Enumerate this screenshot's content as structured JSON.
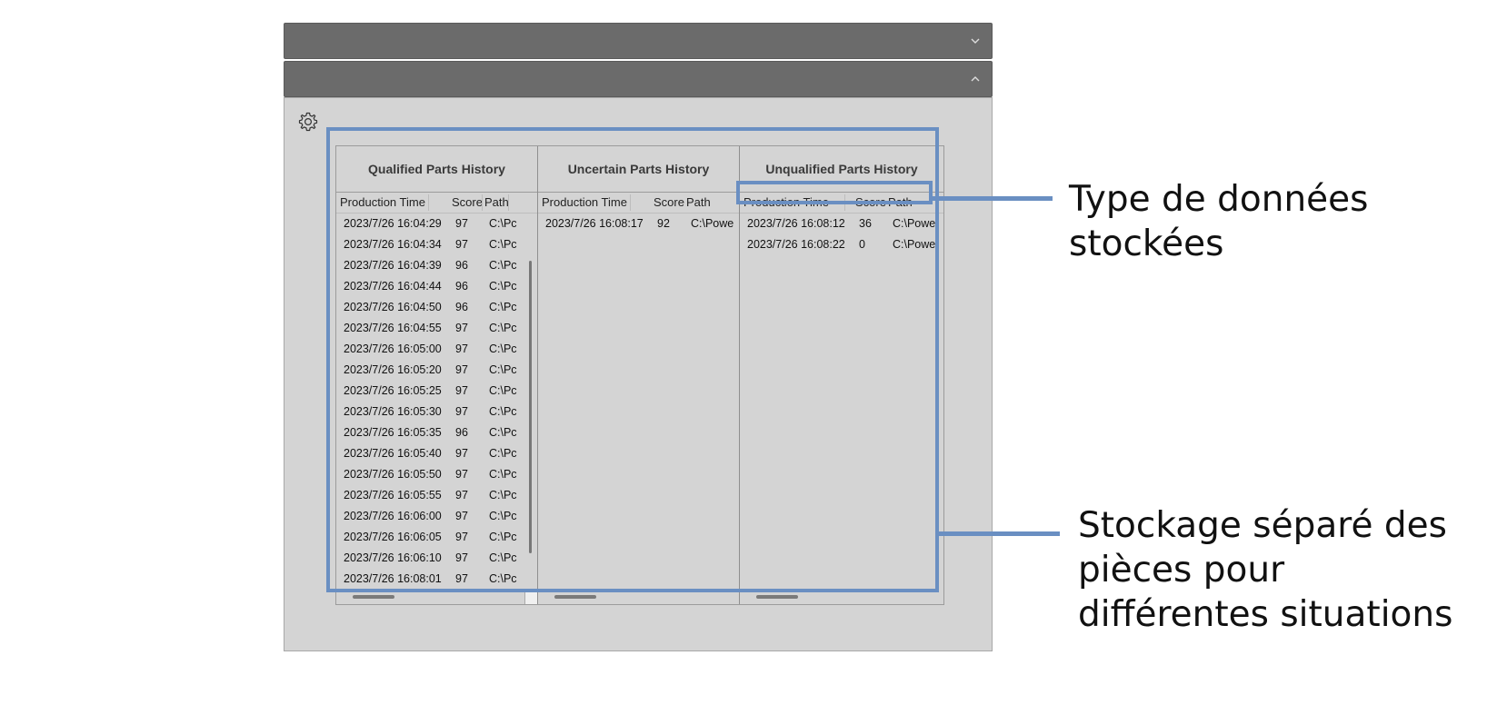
{
  "app": {
    "section_collapsed": {
      "title": "",
      "chevron_icon": "chevron-down-icon"
    },
    "section_expanded": {
      "title": "",
      "chevron_icon": "chevron-up-icon"
    },
    "settings_icon": "gear-icon"
  },
  "history": {
    "columns": [
      "Production Time",
      "Score",
      "Path"
    ],
    "qualified": {
      "title": "Qualified Parts History",
      "rows": [
        {
          "time": "2023/7/26 16:04:29",
          "score": "97",
          "path": "C:\\Pc"
        },
        {
          "time": "2023/7/26 16:04:34",
          "score": "97",
          "path": "C:\\Pc"
        },
        {
          "time": "2023/7/26 16:04:39",
          "score": "96",
          "path": "C:\\Pc"
        },
        {
          "time": "2023/7/26 16:04:44",
          "score": "96",
          "path": "C:\\Pc"
        },
        {
          "time": "2023/7/26 16:04:50",
          "score": "96",
          "path": "C:\\Pc"
        },
        {
          "time": "2023/7/26 16:04:55",
          "score": "97",
          "path": "C:\\Pc"
        },
        {
          "time": "2023/7/26 16:05:00",
          "score": "97",
          "path": "C:\\Pc"
        },
        {
          "time": "2023/7/26 16:05:20",
          "score": "97",
          "path": "C:\\Pc"
        },
        {
          "time": "2023/7/26 16:05:25",
          "score": "97",
          "path": "C:\\Pc"
        },
        {
          "time": "2023/7/26 16:05:30",
          "score": "97",
          "path": "C:\\Pc"
        },
        {
          "time": "2023/7/26 16:05:35",
          "score": "96",
          "path": "C:\\Pc"
        },
        {
          "time": "2023/7/26 16:05:40",
          "score": "97",
          "path": "C:\\Pc"
        },
        {
          "time": "2023/7/26 16:05:50",
          "score": "97",
          "path": "C:\\Pc"
        },
        {
          "time": "2023/7/26 16:05:55",
          "score": "97",
          "path": "C:\\Pc"
        },
        {
          "time": "2023/7/26 16:06:00",
          "score": "97",
          "path": "C:\\Pc"
        },
        {
          "time": "2023/7/26 16:06:05",
          "score": "97",
          "path": "C:\\Pc"
        },
        {
          "time": "2023/7/26 16:06:10",
          "score": "97",
          "path": "C:\\Pc"
        },
        {
          "time": "2023/7/26 16:08:01",
          "score": "97",
          "path": "C:\\Pc"
        }
      ]
    },
    "uncertain": {
      "title": "Uncertain Parts History",
      "rows": [
        {
          "time": "2023/7/26 16:08:17",
          "score": "92",
          "path": "C:\\Powe"
        }
      ]
    },
    "unqualified": {
      "title": "Unqualified Parts History",
      "rows": [
        {
          "time": "2023/7/26 16:08:12",
          "score": "36",
          "path": "C:\\Powe"
        },
        {
          "time": "2023/7/26 16:08:22",
          "score": "0",
          "path": "C:\\Powe"
        }
      ]
    }
  },
  "annotations": {
    "data_type": "Type de données stockées",
    "separate_storage": "Stockage séparé des pièces pour différentes situations",
    "highlight_color": "#6a8fc2"
  }
}
